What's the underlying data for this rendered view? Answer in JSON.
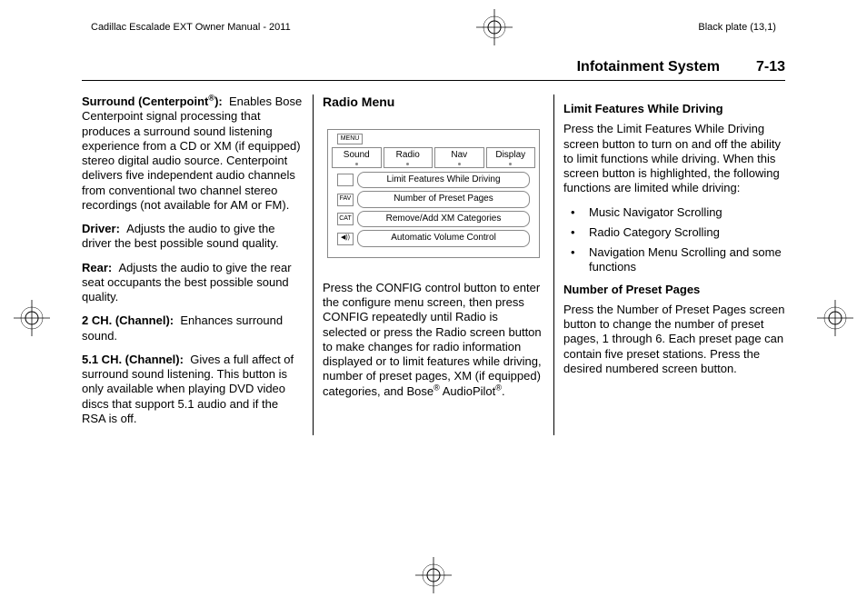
{
  "header": {
    "manual_title": "Cadillac Escalade EXT Owner Manual - 2011",
    "plate": "Black plate (13,1)"
  },
  "section": {
    "title": "Infotainment System",
    "page": "7-13"
  },
  "col1": {
    "surround_label": "Surround (Centerpoint",
    "surround_after": "):",
    "surround_text": "Enables Bose Centerpoint signal processing that produces a surround sound listening experience from a CD or XM (if equipped) stereo digital audio source. Centerpoint delivers five independent audio channels from conventional two channel stereo recordings (not available for AM or FM).",
    "driver_label": "Driver:",
    "driver_text": "Adjusts the audio to give the driver the best possible sound quality.",
    "rear_label": "Rear:",
    "rear_text": "Adjusts the audio to give the rear seat occupants the best possible sound quality.",
    "ch2_label": "2 CH. (Channel):",
    "ch2_text": "Enhances surround sound.",
    "ch51_label": "5.1 CH. (Channel):",
    "ch51_text": "Gives a full affect of surround sound listening. This button is only available when playing DVD video discs that support 5.1 audio and if the RSA is off."
  },
  "col2": {
    "heading": "Radio Menu",
    "fig": {
      "menu_label": "MENU",
      "tabs": [
        "Sound",
        "Radio",
        "Nav",
        "Display"
      ],
      "rows": [
        {
          "icon": "",
          "label": "Limit Features While Driving"
        },
        {
          "icon": "FAV",
          "label": "Number of Preset Pages"
        },
        {
          "icon": "CAT",
          "label": "Remove/Add XM Categories"
        },
        {
          "icon": "◀))",
          "label": "Automatic Volume Control"
        }
      ]
    },
    "body_pre": "Press the CONFIG control button to enter the configure menu screen, then press CONFIG repeatedly until Radio is selected or press the Radio screen button to make changes for radio information displayed or to limit features while driving, number of preset pages, XM (if equipped) categories, and Bose",
    "body_mid": " AudioPilot",
    "body_end": "."
  },
  "col3": {
    "h1": "Limit Features While Driving",
    "p1": "Press the Limit Features While Driving screen button to turn on and off the ability to limit functions while driving. When this screen button is highlighted, the following functions are limited while driving:",
    "bullets": [
      "Music Navigator Scrolling",
      "Radio Category Scrolling",
      "Navigation Menu Scrolling and some functions"
    ],
    "h2": "Number of Preset Pages",
    "p2": "Press the Number of Preset Pages screen button to change the number of preset pages, 1 through 6. Each preset page can contain five preset stations. Press the desired numbered screen button."
  }
}
